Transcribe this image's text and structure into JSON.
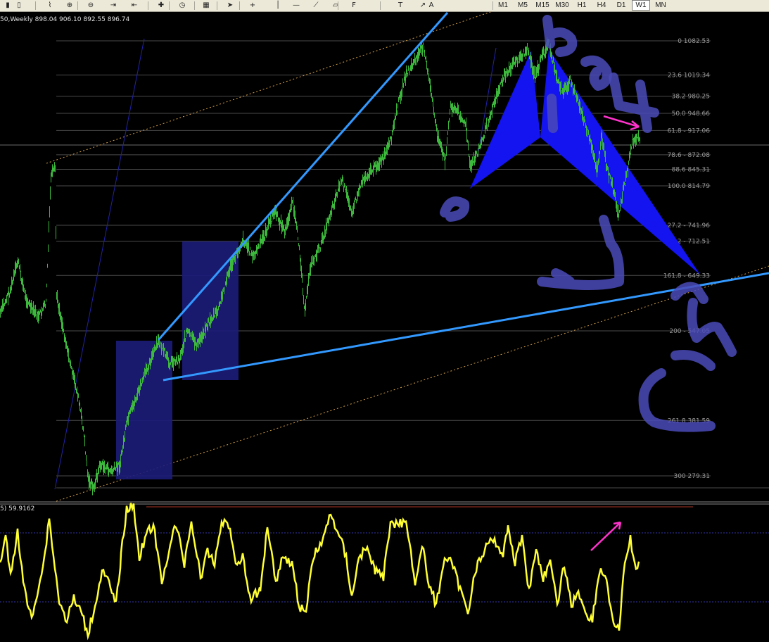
{
  "toolbar": {
    "icons": [
      "chart-bars-icon",
      "chart-candles-icon",
      "chart-line-icon",
      "zoom-in-icon",
      "zoom-out-icon",
      "autoscroll-icon",
      "chart-shift-icon",
      "indicators-icon",
      "periods-icon",
      "templates-icon",
      "cursor-icon",
      "crosshair-icon",
      "vertical-line-icon",
      "horizontal-line-icon",
      "trendline-icon",
      "equidistant-channel-icon",
      "fibonacci-icon",
      "text-icon",
      "text-label-icon",
      "arrows-icon"
    ],
    "text_tool": "A",
    "timeframes": [
      "M1",
      "M5",
      "M15",
      "M30",
      "H1",
      "H4",
      "D1",
      "W1",
      "MN"
    ],
    "active_timeframe": "W1"
  },
  "chart": {
    "title": "50,Weekly  898.04 906.10 892.55 896.74",
    "price_color": "#3cb83c",
    "fib_levels": [
      {
        "label": "0 1082.53",
        "price": 1082.53
      },
      {
        "label": "23.6 1019.34",
        "price": 1019.34
      },
      {
        "label": "38.2 980.25",
        "price": 980.25
      },
      {
        "label": "50.0 948.66",
        "price": 948.66
      },
      {
        "label": "61.8 - 917.06",
        "price": 917.06
      },
      {
        "label": "78.6 - 872.08",
        "price": 872.08
      },
      {
        "label": "88.6 845.31",
        "price": 845.31
      },
      {
        "label": "100.0 814.79",
        "price": 814.79
      },
      {
        "label": "127.2 - 741.96",
        "price": 741.96
      },
      {
        "label": "138.2 - 712.51",
        "price": 712.51
      },
      {
        "label": "161.8 - 649.33",
        "price": 649.33
      },
      {
        "label": "200 - 547.05",
        "price": 547.05
      },
      {
        "label": "261.8 381.59",
        "price": 381.59
      },
      {
        "label": "300 279.31",
        "price": 279.31
      }
    ]
  },
  "indicator": {
    "title": "5) 59.9162",
    "line_color": "#ffff33"
  }
}
